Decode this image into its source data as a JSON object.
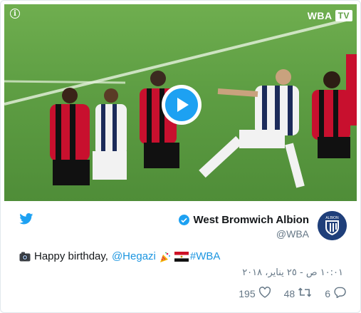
{
  "video": {
    "info_icon": "i",
    "channel_logo": "WBA",
    "channel_tv": "TV"
  },
  "author": {
    "name": "West Bromwich Albion",
    "handle": "@WBA",
    "avatar_label": "ALBION"
  },
  "tweet": {
    "greeting": "Happy birthday,",
    "mention": "@Hegazi",
    "hashtag": "#WBA",
    "timestamp": "١٠:٠١ ص - ٢٥ يناير، ٢٠١٨"
  },
  "actions": {
    "likes": "195",
    "retweets": "48",
    "replies": "6"
  },
  "colors": {
    "brand_blue": "#1da1f2",
    "link_blue": "#1b95e0",
    "text_gray": "#657786"
  }
}
